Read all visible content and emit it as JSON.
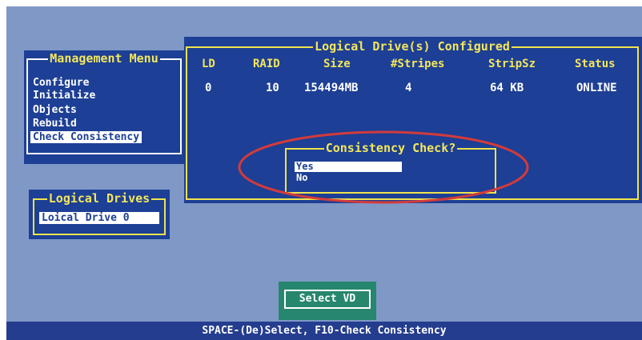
{
  "management_menu": {
    "title": "Management Menu",
    "items": [
      {
        "label": "Configure"
      },
      {
        "label": "Initialize"
      },
      {
        "label": "Objects"
      },
      {
        "label": "Rebuild"
      },
      {
        "label": "Check Consistency",
        "selected": true
      }
    ]
  },
  "logical_drives": {
    "title": "Logical Drives",
    "item": "Loical Drive 0"
  },
  "configured_panel": {
    "title": "Logical Drive(s) Configured",
    "columns": [
      "LD",
      "RAID",
      "Size",
      "#Stripes",
      "StripSz",
      "Status"
    ],
    "rows": [
      {
        "ld": "0",
        "raid": "10",
        "size": "154494MB",
        "stripes": "4",
        "stripsz": "64 KB",
        "status": "ONLINE"
      }
    ]
  },
  "consistency_dialog": {
    "title": "Consistency Check?",
    "options": [
      {
        "label": "Yes",
        "selected": true
      },
      {
        "label": "No",
        "selected": false
      }
    ]
  },
  "select_vd_button": "Select VD",
  "status_bar": "SPACE-(De)Select, F10-Check Consistency",
  "colors": {
    "background": "#7f98c6",
    "panel": "#1d3f95",
    "title_text": "#f3e65c",
    "button_bg": "#27866e",
    "highlight_ellipse": "#d23b3b"
  }
}
